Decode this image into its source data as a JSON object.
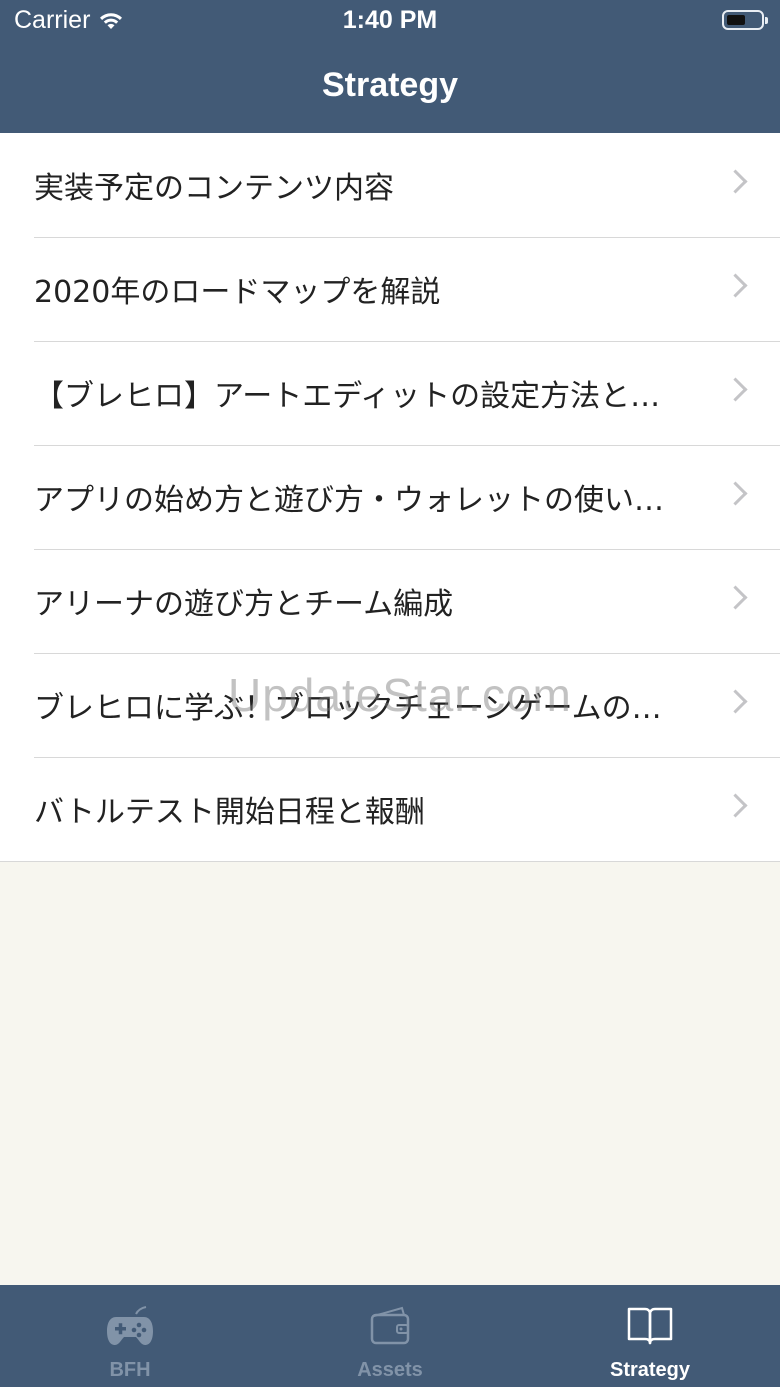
{
  "status_bar": {
    "carrier": "Carrier",
    "time": "1:40 PM"
  },
  "nav": {
    "title": "Strategy"
  },
  "list": {
    "items": [
      {
        "label": "実装予定のコンテンツ内容"
      },
      {
        "label": "2020年のロードマップを解説"
      },
      {
        "label": "【ブレヒロ】アートエディットの設定方法と…"
      },
      {
        "label": "アプリの始め方と遊び方・ウォレットの使い…"
      },
      {
        "label": "アリーナの遊び方とチーム編成"
      },
      {
        "label": "ブレヒロに学ぶ！ブロックチェーンゲームの…"
      },
      {
        "label": "バトルテスト開始日程と報酬"
      }
    ]
  },
  "tabbar": {
    "tabs": [
      {
        "label": "BFH",
        "icon": "gamepad-icon",
        "active": false
      },
      {
        "label": "Assets",
        "icon": "wallet-icon",
        "active": false
      },
      {
        "label": "Strategy",
        "icon": "book-icon",
        "active": true
      }
    ]
  },
  "watermark": "UpdateStar.com",
  "colors": {
    "nav_background": "#425a76",
    "content_background": "#f7f6ef",
    "inactive_tab": "#8193a8",
    "active_tab": "#ffffff",
    "chevron": "#c4c4c7"
  }
}
